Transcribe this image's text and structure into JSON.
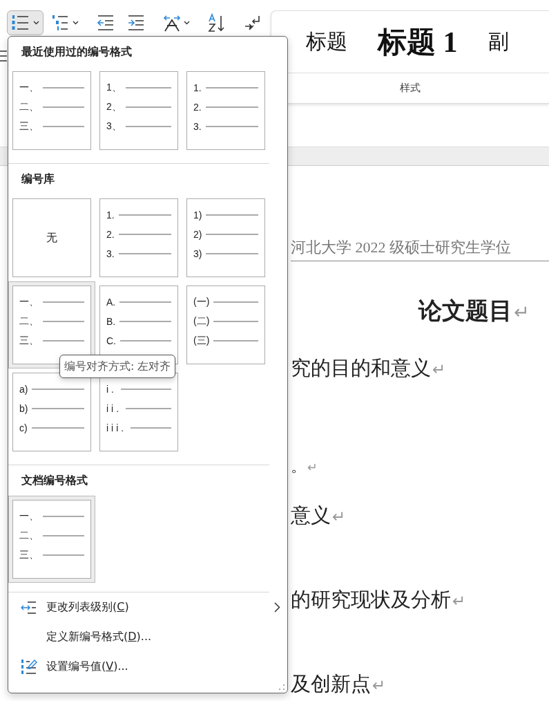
{
  "toolbar": {
    "groups": [
      [
        {
          "kind": "numbering",
          "selected": true,
          "caret": true
        },
        {
          "kind": "multilevel",
          "selected": false,
          "caret": true
        }
      ],
      [
        {
          "kind": "decrease-indent",
          "selected": false,
          "caret": false
        },
        {
          "kind": "increase-indent",
          "selected": false,
          "caret": false
        }
      ],
      [
        {
          "kind": "asian-layout",
          "selected": false,
          "caret": true
        }
      ],
      [
        {
          "kind": "sort",
          "selected": false,
          "caret": false
        }
      ],
      [
        {
          "kind": "line-break",
          "selected": false,
          "caret": false
        }
      ]
    ]
  },
  "styles": {
    "items": [
      {
        "kind": "title",
        "text": "标题"
      },
      {
        "kind": "heading1",
        "text": "标题 1"
      },
      {
        "kind": "subtitle",
        "text": "副"
      }
    ],
    "label": "样式"
  },
  "document": {
    "paragraphs": [
      {
        "kind": "header",
        "text": "河北大学 2022 级硕士研究生学位"
      },
      {
        "kind": "title",
        "text": "论文题目",
        "mark": "↵"
      },
      {
        "kind": "heading",
        "text": "究的目的和意义",
        "mark": "↵"
      },
      {
        "kind": "body",
        "text": "。",
        "mark": "↵"
      },
      {
        "kind": "heading",
        "text": "意义",
        "mark": "↵"
      },
      {
        "kind": "heading",
        "text": "的研究现状及分析",
        "mark": "↵"
      },
      {
        "kind": "heading",
        "text": "及创新点",
        "mark": "↵"
      }
    ]
  },
  "menu": {
    "sections": [
      {
        "heading": "最近使用过的编号格式",
        "tiles": [
          {
            "kind": "list",
            "selected": false,
            "numbers": [
              "一、",
              "二、",
              "三、"
            ]
          },
          {
            "kind": "list",
            "selected": false,
            "numbers": [
              "1、",
              "2、",
              "3、"
            ]
          },
          {
            "kind": "list",
            "selected": false,
            "numbers": [
              "1.",
              "2.",
              "3."
            ]
          }
        ]
      },
      {
        "heading": "编号库",
        "tiles": [
          {
            "kind": "none",
            "selected": false,
            "label": "无"
          },
          {
            "kind": "list",
            "selected": false,
            "numbers": [
              "1.",
              "2.",
              "3."
            ]
          },
          {
            "kind": "list",
            "selected": false,
            "numbers": [
              "1)",
              "2)",
              "3)"
            ]
          },
          {
            "kind": "list",
            "selected": true,
            "numbers": [
              "一、",
              "二、",
              "三、"
            ]
          },
          {
            "kind": "list",
            "selected": false,
            "numbers": [
              "A.",
              "B.",
              "C."
            ]
          },
          {
            "kind": "list",
            "selected": false,
            "numbers": [
              "(一)",
              "(二)",
              "(三)"
            ]
          },
          {
            "kind": "list",
            "selected": false,
            "numbers": [
              "a)",
              "b)",
              "c)"
            ]
          },
          {
            "kind": "list",
            "selected": false,
            "numbers": [
              "i.",
              "ii.",
              "iii."
            ]
          }
        ]
      },
      {
        "heading": "文档编号格式",
        "tiles": [
          {
            "kind": "list",
            "selected": true,
            "numbers": [
              "一、",
              "二、",
              "三、"
            ]
          }
        ]
      }
    ],
    "commands": [
      {
        "kind": "list-level",
        "before": "更改列表级别(",
        "accel": "C",
        "after": ")",
        "submenu": true
      },
      {
        "kind": "plain",
        "before": "定义新编号格式(",
        "accel": "D",
        "after": ")...",
        "submenu": false
      },
      {
        "kind": "set-value",
        "before": "设置编号值(",
        "accel": "V",
        "after": ")...",
        "submenu": false
      }
    ]
  },
  "tooltip": {
    "text": "编号对齐方式: 左对齐"
  }
}
